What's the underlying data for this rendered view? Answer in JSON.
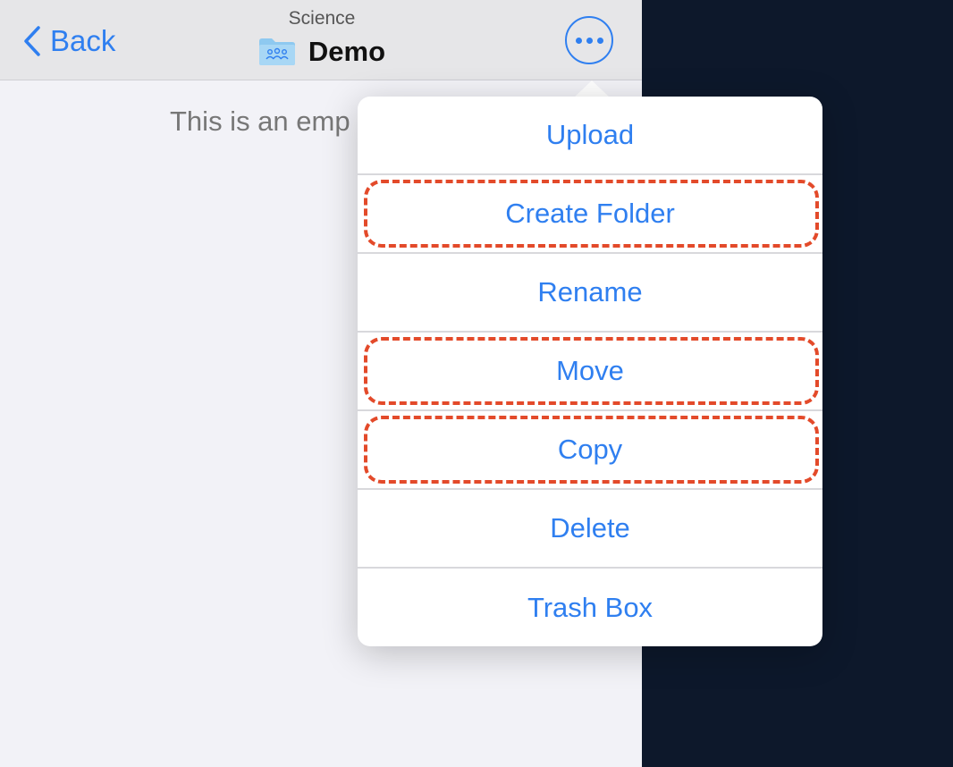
{
  "navbar": {
    "back_label": "Back",
    "subtitle": "Science",
    "title": "Demo",
    "more_icon": "ellipsis-circle-icon",
    "folder_icon": "shared-folder-icon"
  },
  "content": {
    "empty_message": "This is an emp"
  },
  "menu": {
    "items": [
      {
        "label": "Upload",
        "highlighted": false
      },
      {
        "label": "Create Folder",
        "highlighted": true
      },
      {
        "label": "Rename",
        "highlighted": false
      },
      {
        "label": "Move",
        "highlighted": true
      },
      {
        "label": "Copy",
        "highlighted": true
      },
      {
        "label": "Delete",
        "highlighted": false
      },
      {
        "label": "Trash Box",
        "highlighted": false
      }
    ]
  },
  "colors": {
    "accent": "#2f7ff0",
    "highlight": "#e34a2a",
    "backdrop": "#0d182b"
  }
}
